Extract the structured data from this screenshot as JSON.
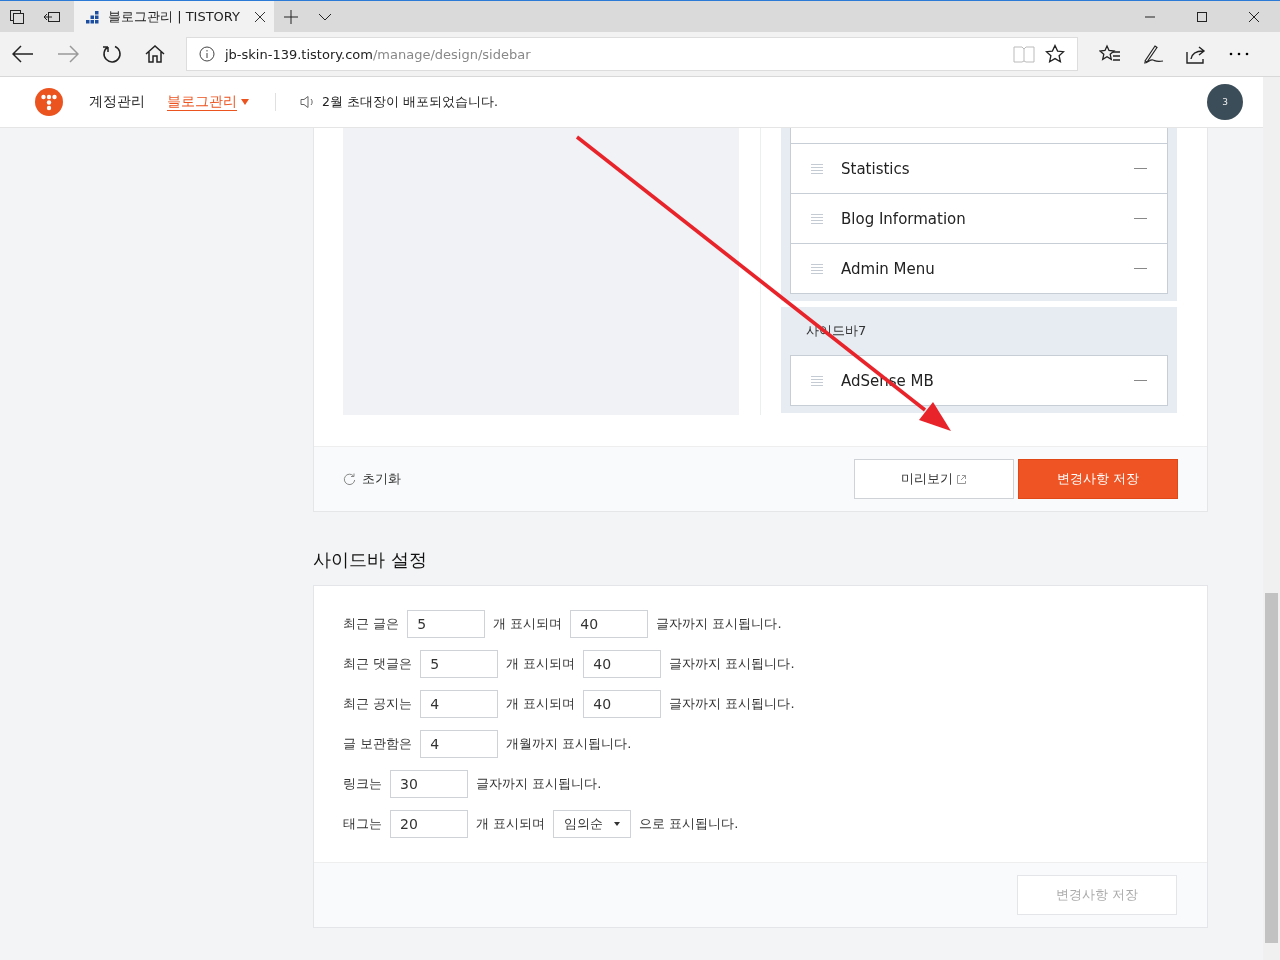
{
  "browser": {
    "tabs": [
      {
        "title": "블로그관리 | TISTORY",
        "selected": true
      }
    ],
    "url_host": "jb-skin-139.tistory.com",
    "url_path": "/manage/design/sidebar"
  },
  "header": {
    "nav": [
      {
        "label": "계정관리",
        "selected": false
      },
      {
        "label": "블로그관리",
        "selected": true
      }
    ],
    "notice": "2월 초대장이 배포되었습니다.",
    "avatar_badge": "3"
  },
  "layout_editor": {
    "groups": [
      {
        "items": [
          {
            "name": "Statistics"
          },
          {
            "name": "Blog Information"
          },
          {
            "name": "Admin Menu"
          }
        ]
      },
      {
        "title": "사이드바7",
        "items": [
          {
            "name": "AdSense MB"
          }
        ]
      }
    ],
    "reset_label": "초기화",
    "preview_button": "미리보기",
    "save_button": "변경사항 저장"
  },
  "sidebar_settings": {
    "title": "사이드바 설정",
    "rows": [
      {
        "parts": [
          {
            "kind": "text",
            "text": "최근 글은"
          },
          {
            "kind": "input",
            "value": "5"
          },
          {
            "kind": "text",
            "text": "개 표시되며"
          },
          {
            "kind": "input",
            "value": "40"
          },
          {
            "kind": "text",
            "text": "글자까지 표시됩니다."
          }
        ]
      },
      {
        "parts": [
          {
            "kind": "text",
            "text": "최근 댓글은"
          },
          {
            "kind": "input",
            "value": "5"
          },
          {
            "kind": "text",
            "text": "개 표시되며"
          },
          {
            "kind": "input",
            "value": "40"
          },
          {
            "kind": "text",
            "text": "글자까지 표시됩니다."
          }
        ]
      },
      {
        "parts": [
          {
            "kind": "text",
            "text": "최근 공지는"
          },
          {
            "kind": "input",
            "value": "4"
          },
          {
            "kind": "text",
            "text": "개 표시되며"
          },
          {
            "kind": "input",
            "value": "40"
          },
          {
            "kind": "text",
            "text": "글자까지 표시됩니다."
          }
        ]
      },
      {
        "parts": [
          {
            "kind": "text",
            "text": "글 보관함은"
          },
          {
            "kind": "input",
            "value": "4"
          },
          {
            "kind": "text",
            "text": "개월까지 표시됩니다."
          }
        ]
      },
      {
        "parts": [
          {
            "kind": "text",
            "text": "링크는"
          },
          {
            "kind": "input",
            "value": "30"
          },
          {
            "kind": "text",
            "text": "글자까지 표시됩니다."
          }
        ]
      },
      {
        "parts": [
          {
            "kind": "text",
            "text": "태그는"
          },
          {
            "kind": "input",
            "value": "20"
          },
          {
            "kind": "text",
            "text": "개 표시되며"
          },
          {
            "kind": "select",
            "value": "임의순"
          },
          {
            "kind": "text",
            "text": "으로 표시됩니다."
          }
        ]
      }
    ],
    "save_button": {
      "label": "변경사항 저장",
      "disabled": true
    }
  }
}
